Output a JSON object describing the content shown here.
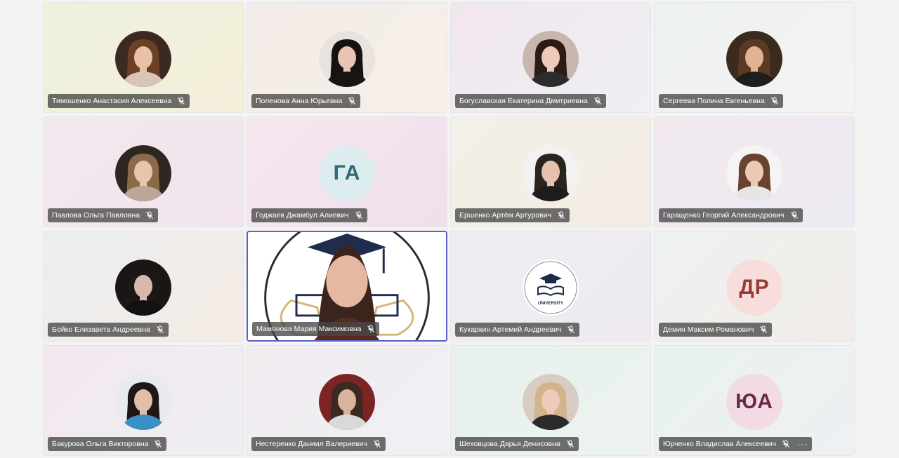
{
  "meeting": {
    "participants": [
      {
        "name": "Тимошенко Анастасия Алексеевна",
        "initials": "",
        "bg": [
          "#eef2dc",
          "#f4eedb"
        ],
        "avatar": {
          "hair": "#6b4027",
          "skin": "#e9c0a8",
          "bg": "#3a2a22",
          "shirt": "#d9c5b8"
        }
      },
      {
        "name": "Поленова Анна Юрьевна",
        "initials": "",
        "bg": [
          "#f3ece8",
          "#f6efe9"
        ],
        "avatar": {
          "hair": "#161212",
          "skin": "#e7c4b4",
          "bg": "#e9e2dd",
          "shirt": "#1a1515"
        }
      },
      {
        "name": "Богуславская Екатерина Дмитриевна",
        "initials": "",
        "bg": [
          "#f2e6ee",
          "#eef0f4"
        ],
        "avatar": {
          "hair": "#2c1c16",
          "skin": "#edc9b8",
          "bg": "#c8b7ae",
          "shirt": "#2c2c2c"
        }
      },
      {
        "name": "Сергеева Полина Евгеньевна",
        "initials": "",
        "bg": [
          "#eef1f2",
          "#f3f3f2"
        ],
        "avatar": {
          "hair": "#5a3a22",
          "skin": "#e0b394",
          "bg": "#3b2a1e",
          "shirt": "#1e1e1e"
        }
      },
      {
        "name": "Павлова Ольга Павловна",
        "initials": "",
        "bg": [
          "#f2e8ef",
          "#f1e4ee"
        ],
        "avatar": {
          "hair": "#8a6a4a",
          "skin": "#e7c4ac",
          "bg": "#2f2622",
          "shirt": "#bca796"
        }
      },
      {
        "name": "Годжаев Джамбул Алиевич",
        "initials": "ГА",
        "initialsColor": "#2f6a73",
        "initialsBg": "#dcecef",
        "bg": [
          "#f6e6ee",
          "#f0e0ec"
        ],
        "avatar": null
      },
      {
        "name": "Ершенко Артём Артурович",
        "initials": "",
        "bg": [
          "#f2f0e8",
          "#f4ece4"
        ],
        "avatar": {
          "hair": "#2a241f",
          "skin": "#e6c2ad",
          "bg": "#f2f2f2",
          "shirt": "#1d1d1d"
        }
      },
      {
        "name": "Гаращенко Георгий Александрович",
        "initials": "",
        "bg": [
          "#f1e8ee",
          "#eeeaf3"
        ],
        "avatar": {
          "hair": "#6a4230",
          "skin": "#ecc9b6",
          "bg": "#f4f4f4",
          "shirt": "#e6e6e6"
        }
      },
      {
        "name": "Бойко Елизавета Андреевна",
        "initials": "",
        "bg": [
          "#ebeef0",
          "#f5ece4"
        ],
        "avatar": {
          "hair": "#1c1716",
          "skin": "#d9b9ad",
          "bg": "#1a1616",
          "shirt": "#111111"
        }
      },
      {
        "name": "Мамонова Мария Максимовна",
        "initials": "",
        "active": true,
        "bg": [
          "#ffffff",
          "#ffffff"
        ],
        "avatar": null
      },
      {
        "name": "Кукаркин Артемий Андреевич",
        "initials": "",
        "bg": [
          "#eceef2",
          "#efe9f1"
        ],
        "avatar": null,
        "logo": "UNIVERSITY"
      },
      {
        "name": "Демин Максим Романович",
        "initials": "ДР",
        "initialsColor": "#9a3a33",
        "initialsBg": "#f7dedd",
        "bg": [
          "#eef2f0",
          "#f1ece8"
        ],
        "avatar": null
      },
      {
        "name": "Бакурова Ольга Викторовна",
        "initials": "",
        "bg": [
          "#f3e8ef",
          "#eeeef3"
        ],
        "avatar": {
          "hair": "#1d1715",
          "skin": "#e2bea9",
          "bg": "#e8eaf0",
          "shirt": "#3a8fc4"
        }
      },
      {
        "name": "Нестеренко Даниил Валериевич",
        "initials": "",
        "bg": [
          "#f2ecf1",
          "#eff0f4"
        ],
        "avatar": {
          "hair": "#3a2a22",
          "skin": "#d9b49c",
          "bg": "#7a2424",
          "shirt": "#d9d9d9"
        }
      },
      {
        "name": "Шеховцова Дарья Денисовна",
        "initials": "",
        "bg": [
          "#e8f1ee",
          "#ecf2ef"
        ],
        "avatar": {
          "hair": "#d2b48c",
          "skin": "#edcbb8",
          "bg": "#d9ccc2",
          "shirt": "#2b2b2b"
        }
      },
      {
        "name": "Юрченко Владислав Алексеевич",
        "initials": "ЮА",
        "initialsColor": "#6b2a44",
        "initialsBg": "#f2dbe5",
        "more": "···",
        "bg": [
          "#e9f2ef",
          "#eef0f2"
        ],
        "avatar": null
      }
    ]
  },
  "colors": {
    "active_border": "#5b5fc7",
    "chip_bg": "#464646"
  },
  "icons": {
    "mic": "mic-muted-icon",
    "more": "more-options-icon"
  }
}
